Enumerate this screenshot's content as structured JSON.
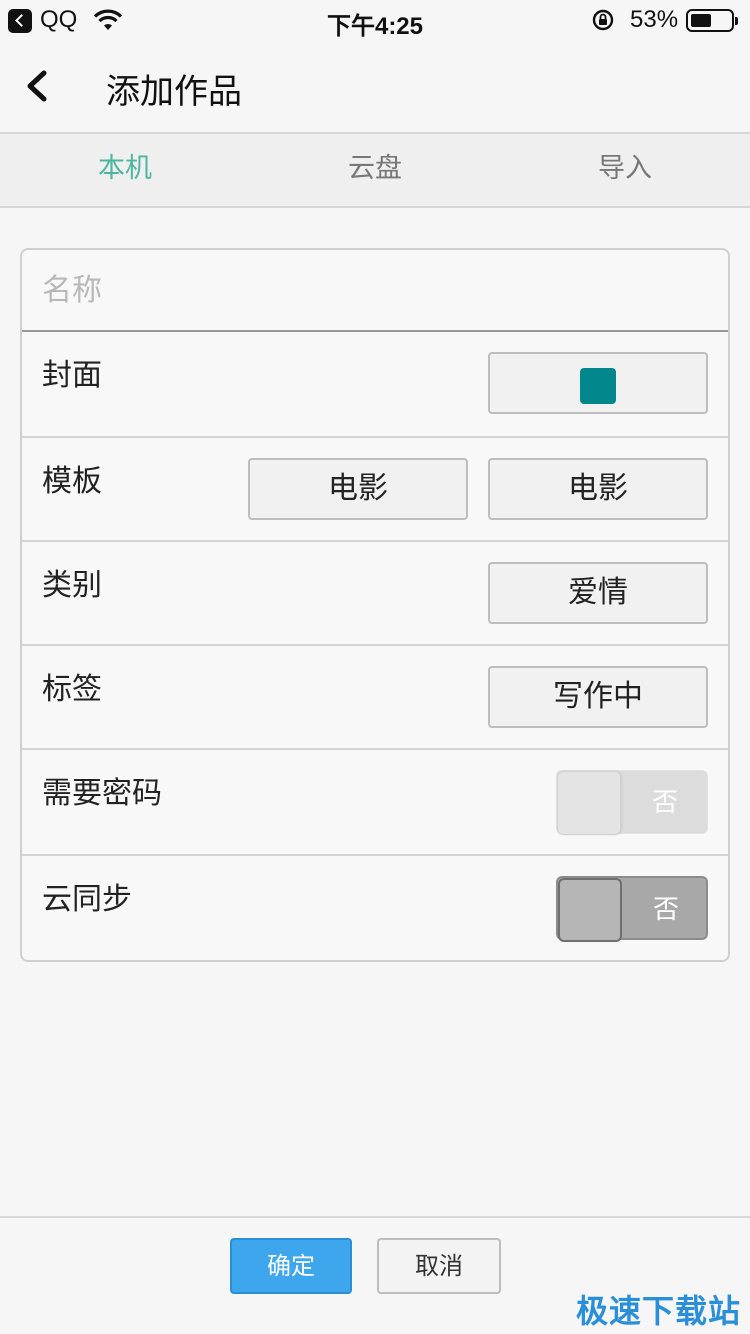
{
  "status_bar": {
    "carrier": "QQ",
    "time": "下午4:25",
    "battery_percent": "53%",
    "battery_level": 0.53
  },
  "nav": {
    "title": "添加作品"
  },
  "tabs": [
    {
      "label": "本机",
      "active": true
    },
    {
      "label": "云盘",
      "active": false
    },
    {
      "label": "导入",
      "active": false
    }
  ],
  "form": {
    "name": {
      "value": "",
      "placeholder": "名称"
    },
    "cover": {
      "label": "封面",
      "swatch_color": "#00868b"
    },
    "template": {
      "label": "模板",
      "options": [
        "电影",
        "电影"
      ]
    },
    "category": {
      "label": "类别",
      "value": "爱情"
    },
    "tag": {
      "label": "标签",
      "value": "写作中"
    },
    "password": {
      "label": "需要密码",
      "toggle_text": "否",
      "enabled": false
    },
    "cloud_sync": {
      "label": "云同步",
      "toggle_text": "否",
      "enabled": false
    }
  },
  "actions": {
    "confirm": "确定",
    "cancel": "取消",
    "accent_color": "#3ea6ec"
  },
  "watermark": "极速下载站"
}
